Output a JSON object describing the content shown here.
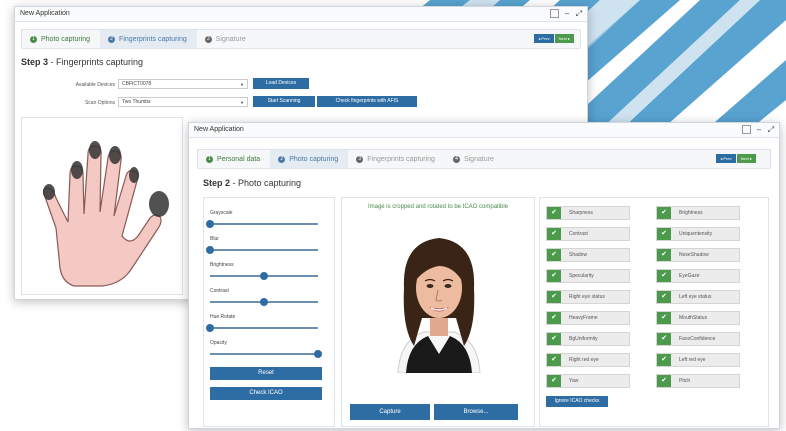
{
  "back_window": {
    "title": "New Application",
    "wizard_steps": [
      {
        "num": "1",
        "label": "Photo capturing"
      },
      {
        "num": "2",
        "label": "Fingerprints capturing"
      },
      {
        "num": "3",
        "label": "Signature"
      }
    ],
    "prev_label": "Prev",
    "next_label": "Next",
    "step_number": "Step 3",
    "step_title": " - Fingerprints capturing",
    "devices_label": "Available Devices",
    "devices_value": "CBFICT0078",
    "load_devices_label": "Load Devices",
    "scan_options_label": "Scan Options",
    "scan_options_value": "Two Thumbs",
    "start_scanning_label": "Start Scanning",
    "check_afis_label": "Check fingerprints with AFIS"
  },
  "front_window": {
    "title": "New Application",
    "wizard_steps": [
      {
        "num": "1",
        "label": "Personal data"
      },
      {
        "num": "2",
        "label": "Photo capturing"
      },
      {
        "num": "3",
        "label": "Fingerprints capturing"
      },
      {
        "num": "4",
        "label": "Signature"
      }
    ],
    "prev_label": "Prev",
    "next_label": "Next",
    "step_number": "Step 2",
    "step_title": " - Photo capturing",
    "sliders": [
      {
        "label": "Grayscale",
        "value": 0.0
      },
      {
        "label": "Blur",
        "value": 0.0
      },
      {
        "label": "Brightness",
        "value": 0.5
      },
      {
        "label": "Contrast",
        "value": 0.5
      },
      {
        "label": "Hue Rotate",
        "value": 0.0
      },
      {
        "label": "Opacity",
        "value": 1.0
      }
    ],
    "reset_label": "Reset",
    "check_icao_label": "Check ICAO",
    "icao_message": "Image is cropped and rotated to be ICAO compatible",
    "capture_label": "Capture",
    "browse_label": "Browse...",
    "checks_left": [
      "Sharpness",
      "Contrast",
      "Shadow",
      "Specularity",
      "Right eye status",
      "HeavyFrame",
      "BgUniformity",
      "Right red eye",
      "Yaw"
    ],
    "checks_right": [
      "Brightness",
      "Uniquentensity",
      "NoseShadow",
      "EyeGaze",
      "Left eye status",
      "MouthStatus",
      "FaceConfidence",
      "Left red eye",
      "Pitch"
    ],
    "ignore_label": "Ignore ICAO checks",
    "check_mark": "✔"
  },
  "colors": {
    "accent": "#2e6da4",
    "success": "#4c9a4c",
    "stripe": "#3c93c8"
  }
}
